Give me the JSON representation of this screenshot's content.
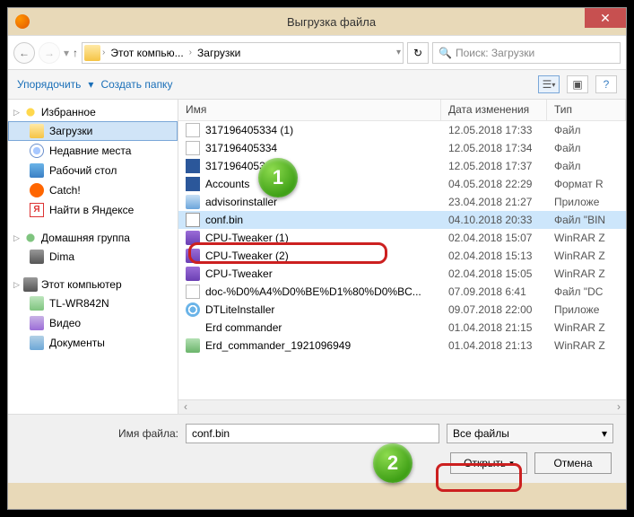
{
  "window": {
    "title": "Выгрузка файла"
  },
  "nav": {
    "breadcrumb": [
      "Этот компью...",
      "Загрузки"
    ],
    "search_placeholder": "Поиск: Загрузки"
  },
  "toolbar": {
    "organize": "Упорядочить",
    "new_folder": "Создать папку"
  },
  "sidebar": {
    "groups": [
      {
        "title": "Избранное",
        "icon": "i-star",
        "items": [
          {
            "label": "Загрузки",
            "icon": "i-folder",
            "selected": true
          },
          {
            "label": "Недавние места",
            "icon": "i-clock"
          },
          {
            "label": "Рабочий стол",
            "icon": "i-desktop"
          },
          {
            "label": "Catch!",
            "icon": "i-catch"
          },
          {
            "label": "Найти в Яндексе",
            "icon": "i-ya"
          }
        ]
      },
      {
        "title": "Домашняя группа",
        "icon": "i-home",
        "items": [
          {
            "label": "Dima",
            "icon": "i-pc"
          }
        ]
      },
      {
        "title": "Этот компьютер",
        "icon": "i-pc",
        "items": [
          {
            "label": "TL-WR842N",
            "icon": "i-drive"
          },
          {
            "label": "Видео",
            "icon": "i-video"
          },
          {
            "label": "Документы",
            "icon": "i-doc"
          }
        ]
      }
    ]
  },
  "filelist": {
    "columns": {
      "name": "Имя",
      "date": "Дата изменения",
      "type": "Тип"
    },
    "rows": [
      {
        "icon": "fi-file",
        "name": "317196405334 (1)",
        "date": "12.05.2018 17:33",
        "type": "Файл"
      },
      {
        "icon": "fi-file",
        "name": "317196405334",
        "date": "12.05.2018 17:34",
        "type": "Файл"
      },
      {
        "icon": "fi-word",
        "name": "317196405334",
        "date": "12.05.2018 17:37",
        "type": "Файл"
      },
      {
        "icon": "fi-word",
        "name": "Accounts",
        "date": "04.05.2018 22:29",
        "type": "Формат R"
      },
      {
        "icon": "fi-exe",
        "name": "advisorinstaller",
        "date": "23.04.2018 21:27",
        "type": "Приложе"
      },
      {
        "icon": "fi-bin",
        "name": "conf.bin",
        "date": "04.10.2018 20:33",
        "type": "Файл \"BIN",
        "selected": true
      },
      {
        "icon": "fi-rar",
        "name": "CPU-Tweaker (1)",
        "date": "02.04.2018 15:07",
        "type": "WinRAR Z"
      },
      {
        "icon": "fi-rar",
        "name": "CPU-Tweaker (2)",
        "date": "02.04.2018 15:13",
        "type": "WinRAR Z"
      },
      {
        "icon": "fi-rar",
        "name": "CPU-Tweaker",
        "date": "02.04.2018 15:05",
        "type": "WinRAR Z"
      },
      {
        "icon": "fi-file",
        "name": "doc-%D0%A4%D0%BE%D1%80%D0%BC...",
        "date": "07.09.2018 6:41",
        "type": "Файл \"DC"
      },
      {
        "icon": "fi-disc",
        "name": "DTLiteInstaller",
        "date": "09.07.2018 22:00",
        "type": "Приложе"
      },
      {
        "icon": "fi-folder",
        "name": "Erd commander",
        "date": "01.04.2018 21:15",
        "type": "WinRAR Z"
      },
      {
        "icon": "fi-pic",
        "name": "Erd_commander_1921096949",
        "date": "01.04.2018 21:13",
        "type": "WinRAR Z"
      }
    ]
  },
  "bottom": {
    "filename_label": "Имя файла:",
    "filename_value": "conf.bin",
    "filter": "Все файлы",
    "open": "Открыть",
    "cancel": "Отмена"
  },
  "annotations": {
    "b1": "1",
    "b2": "2"
  }
}
